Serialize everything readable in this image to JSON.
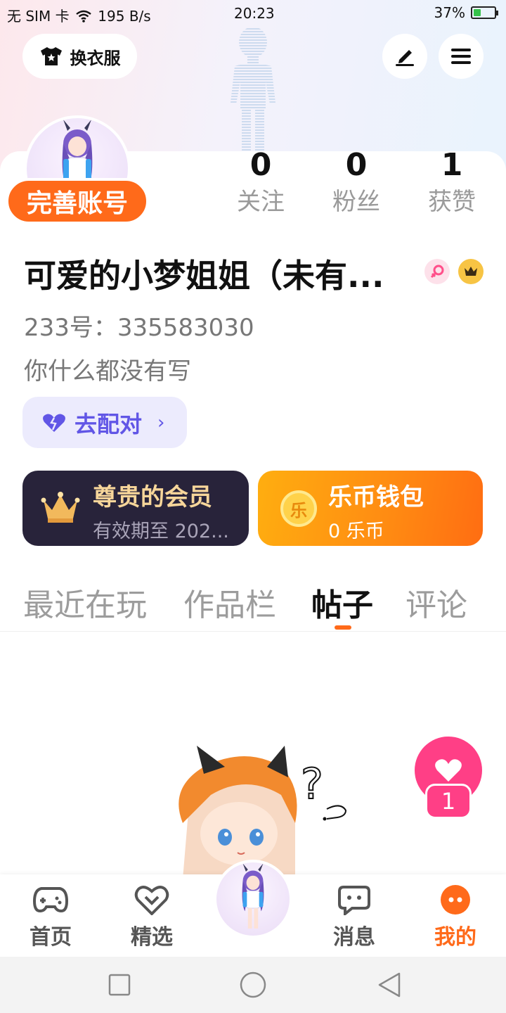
{
  "status_bar": {
    "left": "无 SIM 卡",
    "speed": "195 B/s",
    "time": "20:23",
    "battery": "37%",
    "battery_level": 0.37
  },
  "header": {
    "dress_up_label": "换衣服"
  },
  "profile": {
    "complete_account_label": "完善账号",
    "stats": [
      {
        "value": "0",
        "label": "关注"
      },
      {
        "value": "0",
        "label": "粉丝"
      },
      {
        "value": "1",
        "label": "获赞"
      }
    ],
    "username": "可爱的小梦姐姐（未有...",
    "id_line": "233号：335583030",
    "bio": "你什么都没有写",
    "pair_label": "去配对"
  },
  "cards": {
    "vip_title": "尊贵的会员",
    "vip_sub": "有效期至 202...",
    "wallet_title": "乐币钱包",
    "wallet_sub": "0 乐币",
    "coin_glyph": "乐"
  },
  "tabs": [
    {
      "label": "最近在玩",
      "active": false
    },
    {
      "label": "作品栏",
      "active": false
    },
    {
      "label": "帖子",
      "active": true
    },
    {
      "label": "评论",
      "active": false
    }
  ],
  "like_fab": {
    "count": "1"
  },
  "bottom_nav": [
    {
      "label": "首页",
      "icon": "gamepad-icon",
      "active": false
    },
    {
      "label": "精选",
      "icon": "heart-chat-icon",
      "active": false
    },
    {
      "label": "消息",
      "icon": "message-icon",
      "active": false
    },
    {
      "label": "我的",
      "icon": "me-icon",
      "active": true
    }
  ],
  "colors": {
    "accent": "#ff6a1a",
    "like": "#ff3f86",
    "pair": "#6156e6"
  }
}
